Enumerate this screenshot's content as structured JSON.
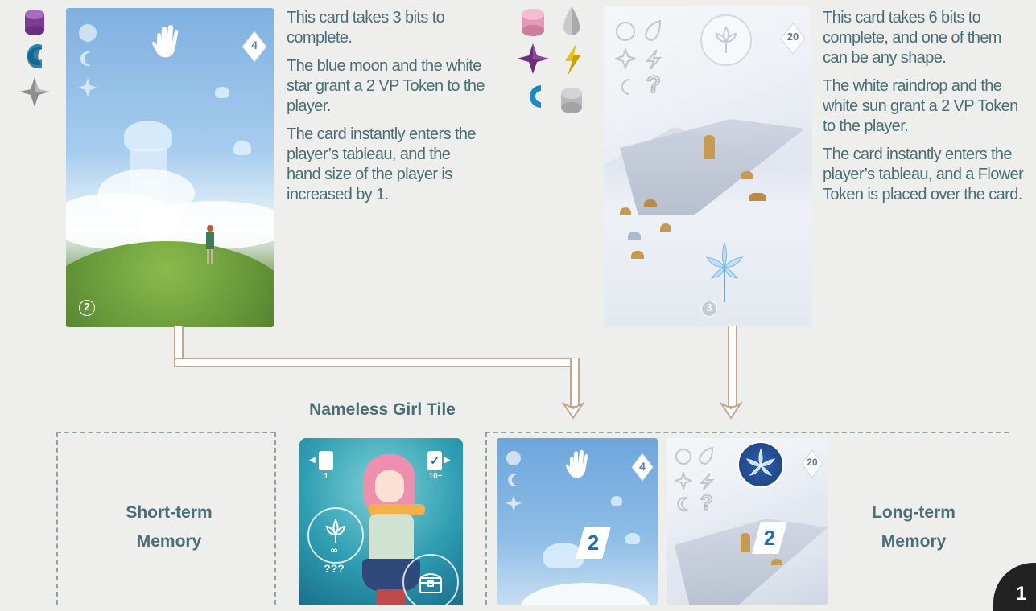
{
  "top_left": {
    "description": [
      "This card takes 3 bits to complete.",
      "The blue moon and the white star grant a 2 VP Token to the player.",
      "The card instantly enters the player’s tableau, and the hand size of the player is increased by 1."
    ],
    "card_points": "4",
    "card_corner": "2"
  },
  "top_right": {
    "description": [
      "This card takes 6 bits to complete, and one of them can be any shape.",
      "The white raindrop and the white sun grant a 2 VP Token to the player.",
      "The card instantly enters the player’s tableau, and a Flower Token is placed over the card."
    ],
    "card_points": "20",
    "card_corner": "3"
  },
  "tile": {
    "title": "Nameless Girl Tile",
    "left_badge": "1",
    "right_badge": "10+",
    "infinity": "∞",
    "question": "???"
  },
  "memory": {
    "short_term": "Short-term Memory",
    "long_term": "Long-term Memory"
  },
  "bottom_cards": {
    "card1_points": "4",
    "card1_token": "2",
    "card2_points": "20",
    "card2_token": "2"
  },
  "page_number": "1",
  "colors": {
    "text": "#4a6d76",
    "background": "#eeeeec",
    "arrow_border": "#c8a489",
    "dash": "#8ea5aa",
    "purple": "#7b3d8f",
    "blue": "#1b8ac0",
    "pink": "#e49ab6",
    "yellow": "#e7c21c"
  }
}
